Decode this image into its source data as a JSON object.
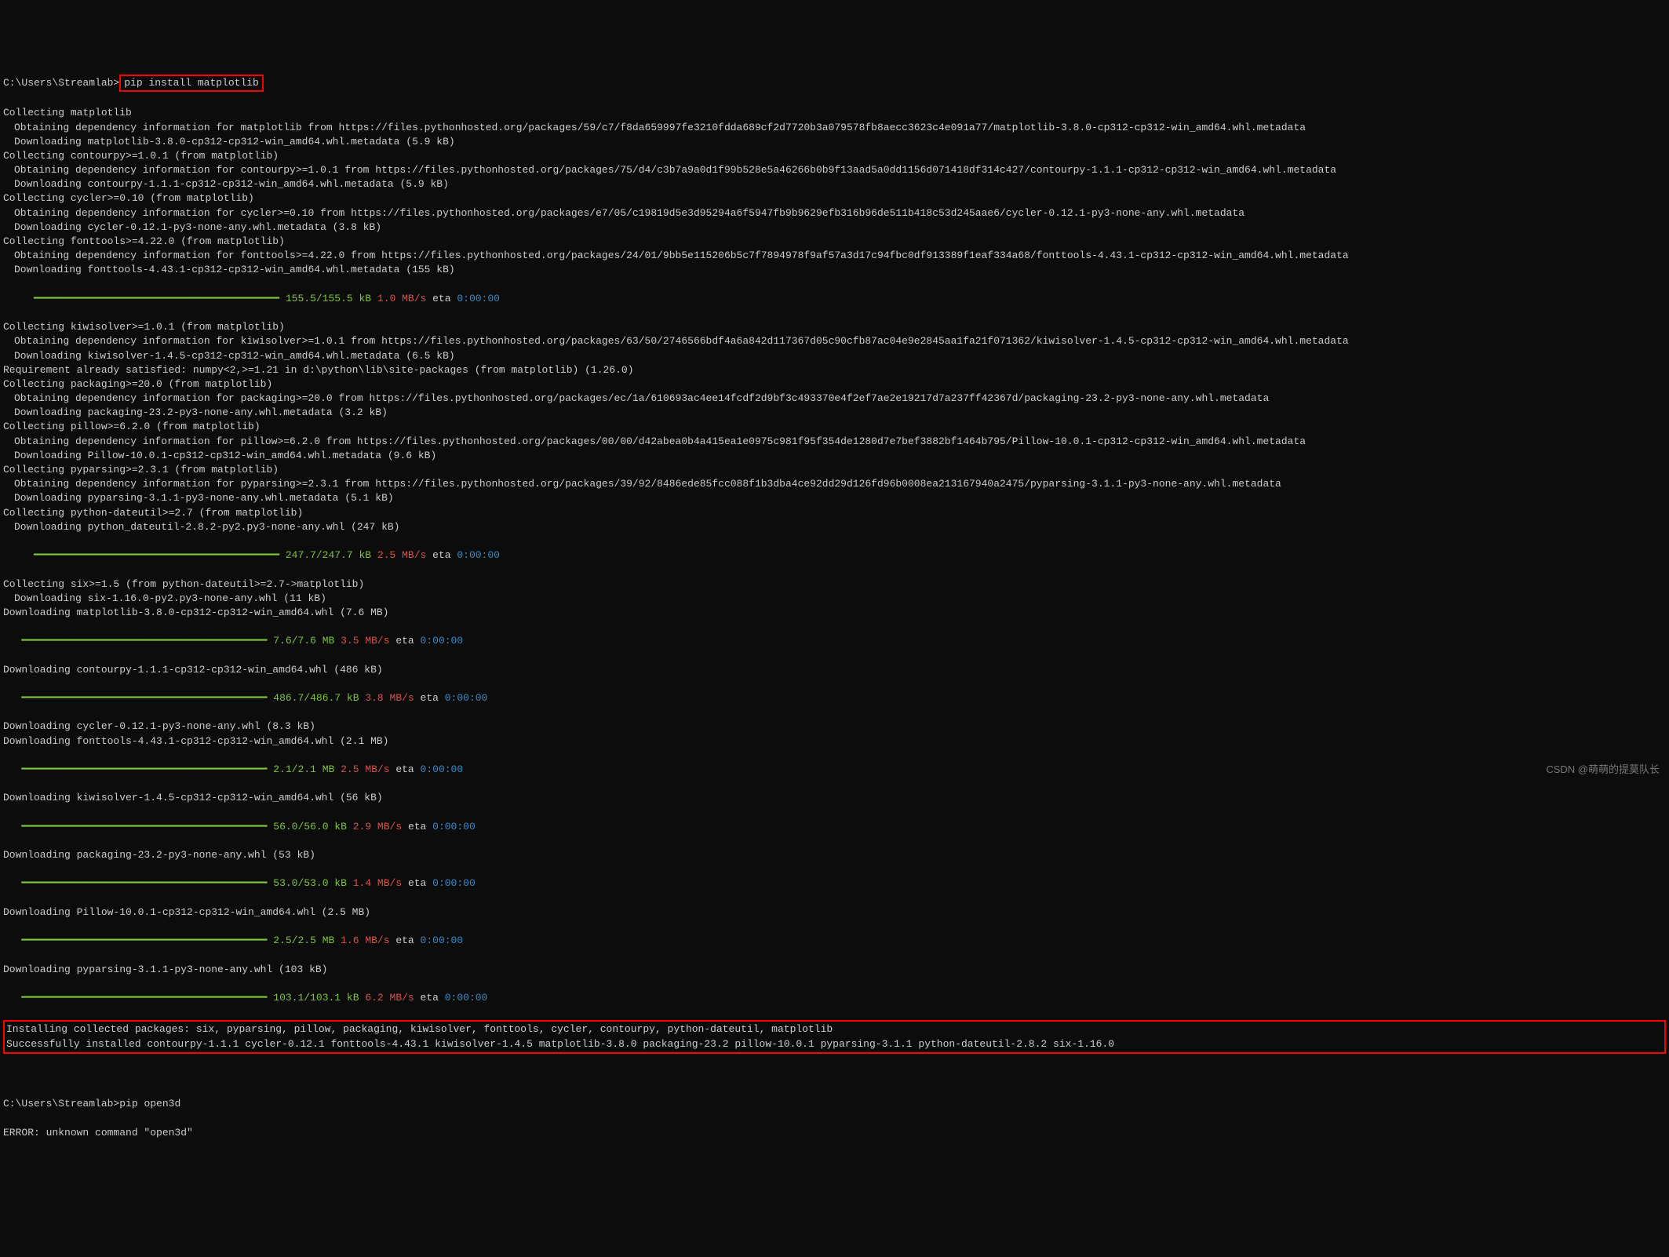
{
  "prompt1": {
    "path": "C:\\Users\\Streamlab>",
    "cmd": "pip install matplotlib"
  },
  "lines": [
    {
      "cls": "white",
      "txt": "Collecting matplotlib"
    },
    {
      "cls": "white indent1",
      "txt": "Obtaining dependency information for matplotlib from https://files.pythonhosted.org/packages/59/c7/f8da659997fe3210fdda689cf2d7720b3a079578fb8aecc3623c4e091a77/matplotlib-3.8.0-cp312-cp312-win_amd64.whl.metadata"
    },
    {
      "cls": "white indent1",
      "txt": "Downloading matplotlib-3.8.0-cp312-cp312-win_amd64.whl.metadata (5.9 kB)"
    },
    {
      "cls": "white",
      "txt": "Collecting contourpy>=1.0.1 (from matplotlib)"
    },
    {
      "cls": "white indent1",
      "txt": "Obtaining dependency information for contourpy>=1.0.1 from https://files.pythonhosted.org/packages/75/d4/c3b7a9a0d1f99b528e5a46266b0b9f13aad5a0dd1156d071418df314c427/contourpy-1.1.1-cp312-cp312-win_amd64.whl.metadata"
    },
    {
      "cls": "white indent1",
      "txt": "Downloading contourpy-1.1.1-cp312-cp312-win_amd64.whl.metadata (5.9 kB)"
    },
    {
      "cls": "white",
      "txt": "Collecting cycler>=0.10 (from matplotlib)"
    },
    {
      "cls": "white indent1",
      "txt": "Obtaining dependency information for cycler>=0.10 from https://files.pythonhosted.org/packages/e7/05/c19819d5e3d95294a6f5947fb9b9629efb316b96de511b418c53d245aae6/cycler-0.12.1-py3-none-any.whl.metadata"
    },
    {
      "cls": "white indent1",
      "txt": "Downloading cycler-0.12.1-py3-none-any.whl.metadata (3.8 kB)"
    },
    {
      "cls": "white",
      "txt": "Collecting fonttools>=4.22.0 (from matplotlib)"
    },
    {
      "cls": "white indent1",
      "txt": "Obtaining dependency information for fonttools>=4.22.0 from https://files.pythonhosted.org/packages/24/01/9bb5e115206b5c7f7894978f9af57a3d17c94fbc0df913389f1eaf334a68/fonttools-4.43.1-cp312-cp312-win_amd64.whl.metadata"
    },
    {
      "cls": "white indent1",
      "txt": "Downloading fonttools-4.43.1-cp312-cp312-win_amd64.whl.metadata (155 kB)"
    }
  ],
  "progress1": {
    "bar": "     ━━━━━━━━━━━━━━━━━━━━━━━━━━━━━━━━━━━━━━━━ ",
    "size": "155.5/155.5 kB",
    "speed": "1.0 MB/s",
    "eta": " eta ",
    "time": "0:00:00"
  },
  "lines2": [
    {
      "cls": "white",
      "txt": "Collecting kiwisolver>=1.0.1 (from matplotlib)"
    },
    {
      "cls": "white indent1",
      "txt": "Obtaining dependency information for kiwisolver>=1.0.1 from https://files.pythonhosted.org/packages/63/50/2746566bdf4a6a842d117367d05c90cfb87ac04e9e2845aa1fa21f071362/kiwisolver-1.4.5-cp312-cp312-win_amd64.whl.metadata"
    },
    {
      "cls": "white indent1",
      "txt": "Downloading kiwisolver-1.4.5-cp312-cp312-win_amd64.whl.metadata (6.5 kB)"
    },
    {
      "cls": "white",
      "txt": "Requirement already satisfied: numpy<2,>=1.21 in d:\\python\\lib\\site-packages (from matplotlib) (1.26.0)"
    },
    {
      "cls": "white",
      "txt": "Collecting packaging>=20.0 (from matplotlib)"
    },
    {
      "cls": "white indent1",
      "txt": "Obtaining dependency information for packaging>=20.0 from https://files.pythonhosted.org/packages/ec/1a/610693ac4ee14fcdf2d9bf3c493370e4f2ef7ae2e19217d7a237ff42367d/packaging-23.2-py3-none-any.whl.metadata"
    },
    {
      "cls": "white indent1",
      "txt": "Downloading packaging-23.2-py3-none-any.whl.metadata (3.2 kB)"
    },
    {
      "cls": "white",
      "txt": "Collecting pillow>=6.2.0 (from matplotlib)"
    },
    {
      "cls": "white indent1",
      "txt": "Obtaining dependency information for pillow>=6.2.0 from https://files.pythonhosted.org/packages/00/00/d42abea0b4a415ea1e0975c981f95f354de1280d7e7bef3882bf1464b795/Pillow-10.0.1-cp312-cp312-win_amd64.whl.metadata"
    },
    {
      "cls": "white indent1",
      "txt": "Downloading Pillow-10.0.1-cp312-cp312-win_amd64.whl.metadata (9.6 kB)"
    },
    {
      "cls": "white",
      "txt": "Collecting pyparsing>=2.3.1 (from matplotlib)"
    },
    {
      "cls": "white indent1",
      "txt": "Obtaining dependency information for pyparsing>=2.3.1 from https://files.pythonhosted.org/packages/39/92/8486ede85fcc088f1b3dba4ce92dd29d126fd96b0008ea213167940a2475/pyparsing-3.1.1-py3-none-any.whl.metadata"
    },
    {
      "cls": "white indent1",
      "txt": "Downloading pyparsing-3.1.1-py3-none-any.whl.metadata (5.1 kB)"
    },
    {
      "cls": "white",
      "txt": "Collecting python-dateutil>=2.7 (from matplotlib)"
    },
    {
      "cls": "white indent1",
      "txt": "Downloading python_dateutil-2.8.2-py2.py3-none-any.whl (247 kB)"
    }
  ],
  "progress2": {
    "bar": "     ━━━━━━━━━━━━━━━━━━━━━━━━━━━━━━━━━━━━━━━━ ",
    "size": "247.7/247.7 kB",
    "speed": "2.5 MB/s",
    "eta": " eta ",
    "time": "0:00:00"
  },
  "lines3": [
    {
      "cls": "white",
      "txt": "Collecting six>=1.5 (from python-dateutil>=2.7->matplotlib)"
    },
    {
      "cls": "white indent1",
      "txt": "Downloading six-1.16.0-py2.py3-none-any.whl (11 kB)"
    },
    {
      "cls": "white",
      "txt": "Downloading matplotlib-3.8.0-cp312-cp312-win_amd64.whl (7.6 MB)"
    }
  ],
  "progress3": {
    "bar": "   ━━━━━━━━━━━━━━━━━━━━━━━━━━━━━━━━━━━━━━━━ ",
    "size": "7.6/7.6 MB",
    "speed": "3.5 MB/s",
    "eta": " eta ",
    "time": "0:00:00"
  },
  "lines4": [
    {
      "cls": "white",
      "txt": "Downloading contourpy-1.1.1-cp312-cp312-win_amd64.whl (486 kB)"
    }
  ],
  "progress4": {
    "bar": "   ━━━━━━━━━━━━━━━━━━━━━━━━━━━━━━━━━━━━━━━━ ",
    "size": "486.7/486.7 kB",
    "speed": "3.8 MB/s",
    "eta": " eta ",
    "time": "0:00:00"
  },
  "lines5": [
    {
      "cls": "white",
      "txt": "Downloading cycler-0.12.1-py3-none-any.whl (8.3 kB)"
    },
    {
      "cls": "white",
      "txt": "Downloading fonttools-4.43.1-cp312-cp312-win_amd64.whl (2.1 MB)"
    }
  ],
  "progress5": {
    "bar": "   ━━━━━━━━━━━━━━━━━━━━━━━━━━━━━━━━━━━━━━━━ ",
    "size": "2.1/2.1 MB",
    "speed": "2.5 MB/s",
    "eta": " eta ",
    "time": "0:00:00"
  },
  "lines6": [
    {
      "cls": "white",
      "txt": "Downloading kiwisolver-1.4.5-cp312-cp312-win_amd64.whl (56 kB)"
    }
  ],
  "progress6": {
    "bar": "   ━━━━━━━━━━━━━━━━━━━━━━━━━━━━━━━━━━━━━━━━ ",
    "size": "56.0/56.0 kB",
    "speed": "2.9 MB/s",
    "eta": " eta ",
    "time": "0:00:00"
  },
  "lines7": [
    {
      "cls": "white",
      "txt": "Downloading packaging-23.2-py3-none-any.whl (53 kB)"
    }
  ],
  "progress7": {
    "bar": "   ━━━━━━━━━━━━━━━━━━━━━━━━━━━━━━━━━━━━━━━━ ",
    "size": "53.0/53.0 kB",
    "speed": "1.4 MB/s",
    "eta": " eta ",
    "time": "0:00:00"
  },
  "lines8": [
    {
      "cls": "white",
      "txt": "Downloading Pillow-10.0.1-cp312-cp312-win_amd64.whl (2.5 MB)"
    }
  ],
  "progress8": {
    "bar": "   ━━━━━━━━━━━━━━━━━━━━━━━━━━━━━━━━━━━━━━━━ ",
    "size": "2.5/2.5 MB",
    "speed": "1.6 MB/s",
    "eta": " eta ",
    "time": "0:00:00"
  },
  "lines9": [
    {
      "cls": "white",
      "txt": "Downloading pyparsing-3.1.1-py3-none-any.whl (103 kB)"
    }
  ],
  "progress9": {
    "bar": "   ━━━━━━━━━━━━━━━━━━━━━━━━━━━━━━━━━━━━━━━━ ",
    "size": "103.1/103.1 kB",
    "speed": "6.2 MB/s",
    "eta": " eta ",
    "time": "0:00:00"
  },
  "install_box": {
    "line1": "Installing collected packages: six, pyparsing, pillow, packaging, kiwisolver, fonttools, cycler, contourpy, python-dateutil, matplotlib",
    "line2": "Successfully installed contourpy-1.1.1 cycler-0.12.1 fonttools-4.43.1 kiwisolver-1.4.5 matplotlib-3.8.0 packaging-23.2 pillow-10.0.1 pyparsing-3.1.1 python-dateutil-2.8.2 six-1.16.0"
  },
  "prompt2": {
    "path": "C:\\Users\\Streamlab>",
    "cmd": "pip open3d"
  },
  "error_line": "ERROR: unknown command \"open3d\"",
  "watermark": "CSDN @萌萌的提莫队长"
}
